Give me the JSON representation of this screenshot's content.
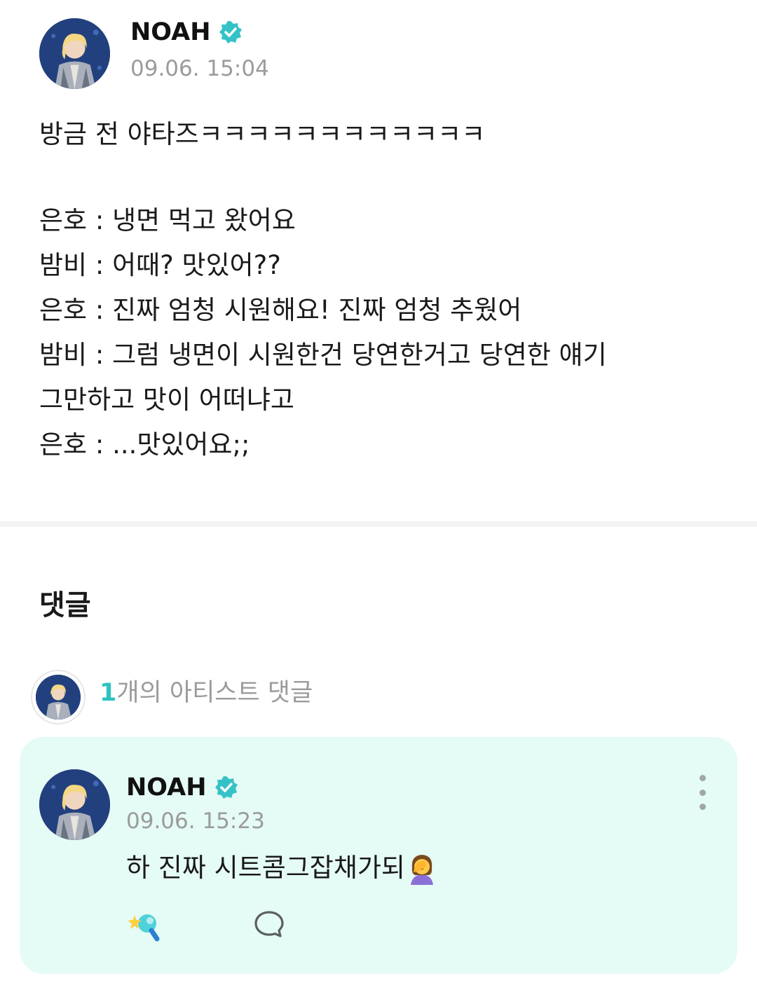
{
  "post": {
    "author": "NOAH",
    "timestamp": "09.06. 15:04",
    "lines": [
      "방금 전 야타즈ㅋㅋㅋㅋㅋㅋㅋㅋㅋㅋㅋㅋ",
      "",
      "은호 : 냉면 먹고 왔어요",
      "밤비 : 어때? 맛있어??",
      "은호 : 진짜 엄청 시원해요! 진짜 엄청 추웠어",
      "밤비 : 그럼 냉면이 시원한건 당연한거고 당연한 얘기",
      "그만하고 맛이 어떠냐고",
      "은호 : ...맛있어요;;"
    ]
  },
  "comments_section": {
    "title": "댓글",
    "artist_summary": {
      "count": "1",
      "label": "개의 아티스트 댓글"
    },
    "comment": {
      "author": "NOAH",
      "timestamp": "09.06. 15:23",
      "text": "하 진짜 시트콤그잡채가되",
      "emoji": "face-palm-woman"
    }
  },
  "colors": {
    "accent": "#2bc4c0",
    "card_background": "#e5fbf5",
    "muted_text": "#9b9b9b",
    "verified_badge": "#35c2c7"
  },
  "icons": {
    "verified": "verified-badge-icon",
    "more": "more-vertical-icon",
    "reaction": "sparkle-reaction-icon",
    "reply": "speech-bubble-icon"
  }
}
